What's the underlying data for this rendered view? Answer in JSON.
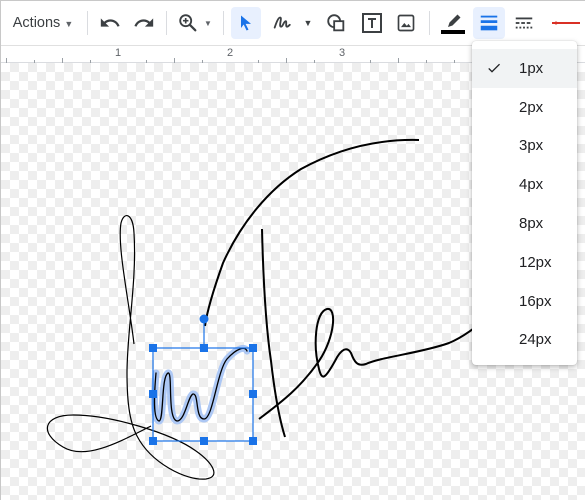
{
  "toolbar": {
    "actions_label": "Actions",
    "items": [
      {
        "name": "undo-icon"
      },
      {
        "name": "redo-icon"
      },
      {
        "name": "zoom-icon"
      },
      {
        "name": "select-icon",
        "active": true
      },
      {
        "name": "scribble-icon"
      },
      {
        "name": "shape-icon"
      },
      {
        "name": "textbox-icon"
      },
      {
        "name": "image-icon"
      },
      {
        "name": "line-color-icon",
        "color": "#000000"
      },
      {
        "name": "line-weight-icon",
        "active": true
      },
      {
        "name": "line-dash-icon"
      },
      {
        "name": "line-start-icon",
        "color": "#d93025"
      }
    ]
  },
  "ruler": {
    "labels": [
      "1",
      "2",
      "3"
    ]
  },
  "line_weight_menu": {
    "selected": "1px",
    "options": [
      "1px",
      "2px",
      "3px",
      "4px",
      "8px",
      "12px",
      "16px",
      "24px"
    ]
  },
  "colors": {
    "accent": "#1a73e8",
    "active_bg": "#e8f0fe",
    "selected_item_bg": "#f1f3f4",
    "stroke": "#000000"
  }
}
